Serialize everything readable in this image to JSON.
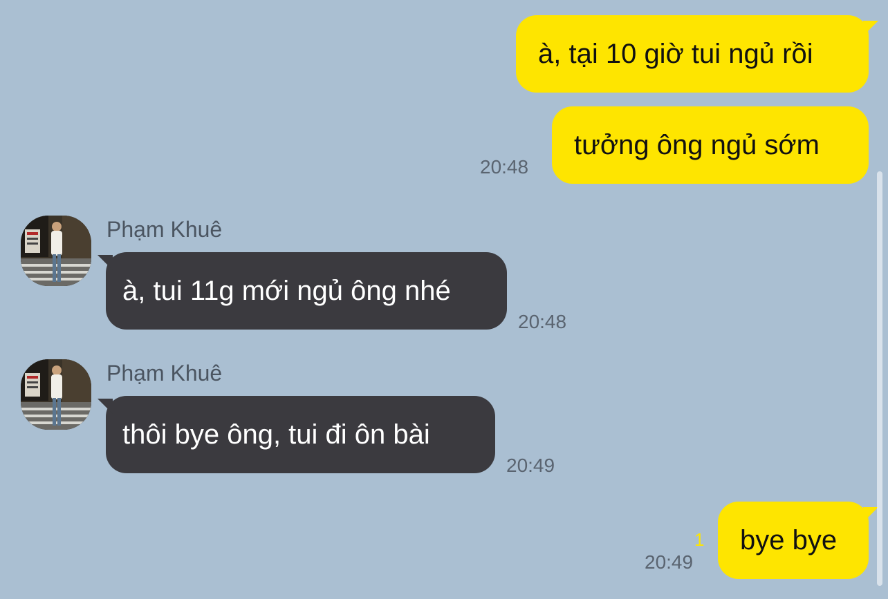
{
  "colors": {
    "background": "#aabfd2",
    "outgoing_bubble": "#fee500",
    "incoming_bubble": "#3b3a3f",
    "timestamp": "#5a6470",
    "unread_count": "#fee500"
  },
  "messages": [
    {
      "direction": "outgoing",
      "text": "à, tại 10 giờ tui ngủ rồi"
    },
    {
      "direction": "outgoing",
      "text": "tưởng ông ngủ sớm",
      "time": "20:48"
    },
    {
      "direction": "incoming",
      "sender": "Phạm Khuê",
      "avatar": "profile-photo-icon",
      "text": "à, tui 11g mới ngủ ông nhé",
      "time": "20:48"
    },
    {
      "direction": "incoming",
      "sender": "Phạm Khuê",
      "avatar": "profile-photo-icon",
      "text": "thôi bye ông, tui đi ôn bài",
      "time": "20:49"
    },
    {
      "direction": "outgoing",
      "text": "bye bye",
      "time": "20:49",
      "unread": "1"
    }
  ]
}
